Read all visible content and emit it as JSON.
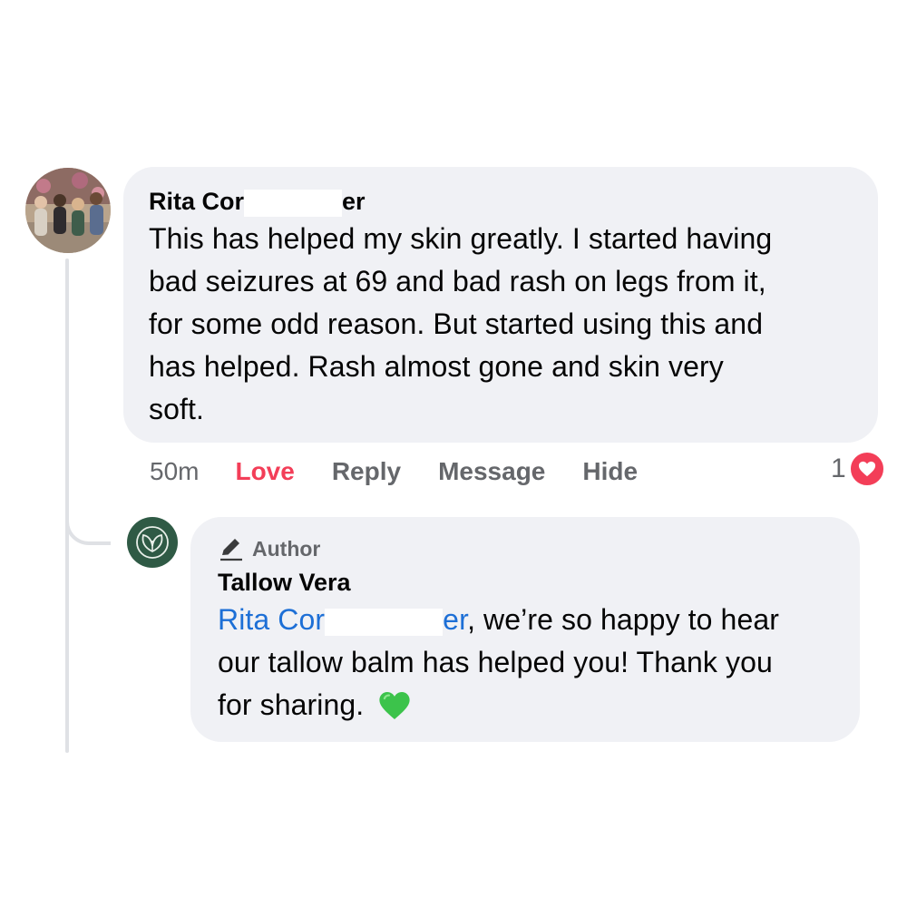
{
  "comment": {
    "author_name_start": "Rita Cor",
    "author_name_end": "er",
    "text_lines": [
      "This has helped my skin greatly.  I started having",
      "bad seizures at 69 and bad rash on legs from it,",
      "for some odd reason.  But started using this and",
      "has helped. Rash almost gone and skin very",
      "soft."
    ],
    "actions": {
      "time": "50m",
      "love": "Love",
      "reply": "Reply",
      "message": "Message",
      "hide": "Hide"
    },
    "reaction_count": "1"
  },
  "reply": {
    "badge_label": "Author",
    "author_name": "Tallow Vera",
    "mention_start": "Rita Cor",
    "mention_end": "er",
    "line1_rest": ", we’re so happy to hear",
    "line2": "our tallow balm has helped you! Thank you",
    "line3": "for sharing."
  },
  "colors": {
    "love": "#f33e58",
    "mention": "#1d6fd6",
    "bubble": "#f0f1f5",
    "brand_logo": "#2f5a45"
  },
  "icons": [
    "love-reaction-icon",
    "pencil-icon",
    "green-heart-icon",
    "tallow-vera-logo-icon"
  ]
}
